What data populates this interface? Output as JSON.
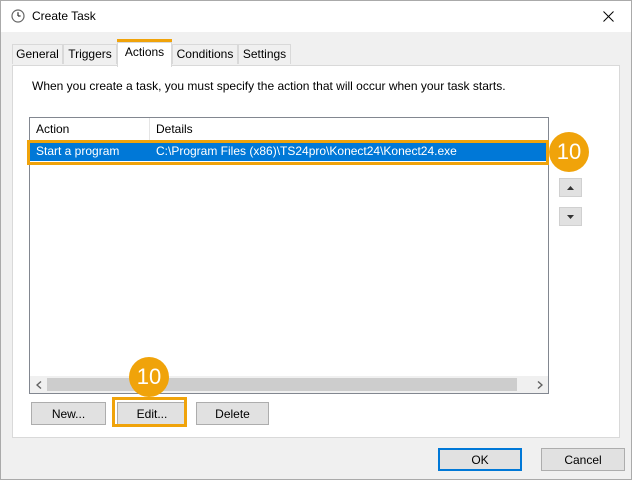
{
  "window": {
    "title": "Create Task",
    "close_glyph": "✕"
  },
  "tabs": [
    {
      "label": "General"
    },
    {
      "label": "Triggers"
    },
    {
      "label": "Actions"
    },
    {
      "label": "Conditions"
    },
    {
      "label": "Settings"
    }
  ],
  "actions_tab": {
    "description": "When you create a task, you must specify the action that will occur when your task starts.",
    "columns": [
      "Action",
      "Details"
    ],
    "rows": [
      {
        "action": "Start a program",
        "details": "C:\\Program Files (x86)\\TS24pro\\Konect24\\Konect24.exe"
      }
    ],
    "new_label": "New...",
    "edit_label": "Edit...",
    "delete_label": "Delete"
  },
  "footer": {
    "ok_label": "OK",
    "cancel_label": "Cancel"
  },
  "callouts": {
    "row_step": "10",
    "edit_step": "10"
  },
  "colors": {
    "accent": "#0078d7",
    "highlight": "#f0a30a"
  },
  "icons": {
    "title": "clock-icon",
    "close": "close-icon",
    "move_up": "arrow-up-icon",
    "move_down": "arrow-down-icon"
  }
}
